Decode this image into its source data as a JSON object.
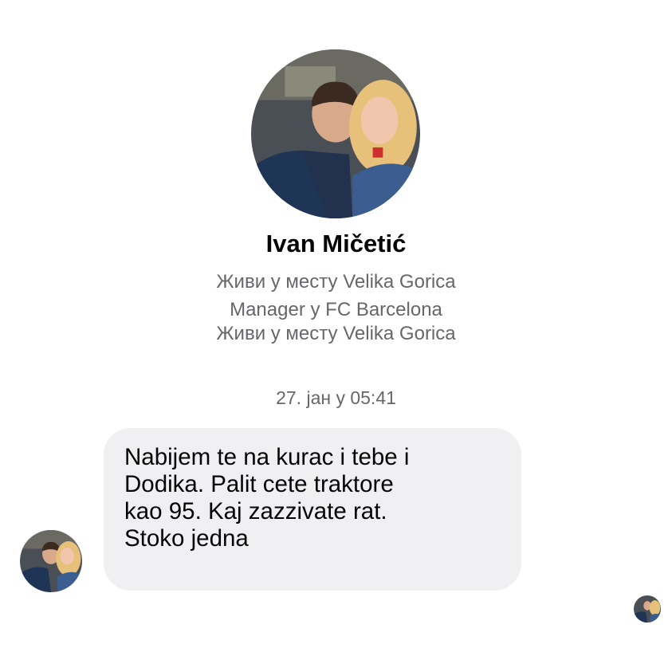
{
  "profile": {
    "name": "Ivan Mičetić",
    "info": [
      "Живи у месту Velika Gorica",
      "Manager у FC Barcelona",
      "Живи у месту Velika Gorica"
    ]
  },
  "conversation": {
    "timestamp": "27. јан у 05:41",
    "message": {
      "lines": [
        "Nabijem te na kurac i tebe i",
        "Dodika. Palit cete traktore",
        "kao 95. Kaj zazzivate rat.",
        "Stoko jedna"
      ]
    }
  },
  "icons": {
    "profile_avatar": "avatar-photo-icon",
    "sender_avatar": "avatar-photo-icon",
    "seen_indicator": "seen-avatar-icon"
  },
  "colors": {
    "bubble": "#f0f0f3",
    "secondary_text": "#65676b",
    "primary_text": "#050505"
  }
}
